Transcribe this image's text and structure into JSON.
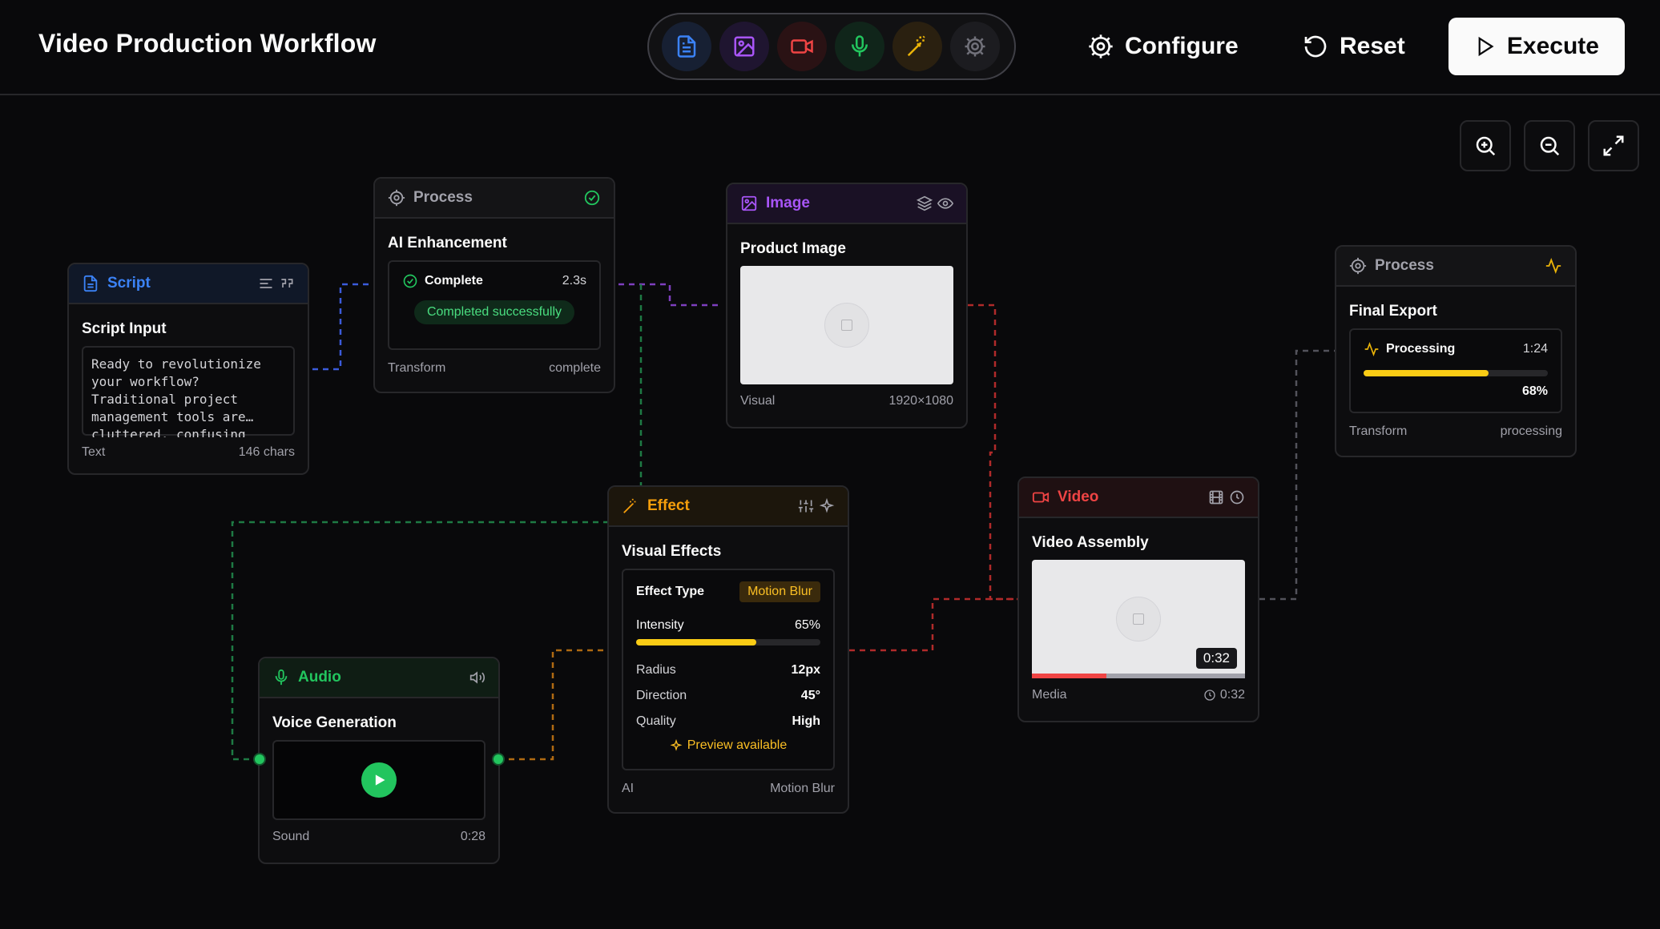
{
  "header": {
    "title": "Video Production Workflow",
    "configure_label": "Configure",
    "reset_label": "Reset",
    "execute_label": "Execute",
    "palette": [
      {
        "icon": "document-icon",
        "color": "#3b82f6"
      },
      {
        "icon": "image-icon",
        "color": "#a855f7"
      },
      {
        "icon": "video-icon",
        "color": "#ef4444"
      },
      {
        "icon": "microphone-icon",
        "color": "#22c55e"
      },
      {
        "icon": "magic-wand-icon",
        "color": "#eab308"
      },
      {
        "icon": "gear-icon",
        "color": "#71717a"
      }
    ]
  },
  "zoom_controls": [
    "zoom-in-icon",
    "zoom-out-icon",
    "fullscreen-icon"
  ],
  "nodes": {
    "script": {
      "category": "Script",
      "title": "Script Input",
      "text": "Ready to revolutionize\nyour workflow?\nTraditional project\nmanagement tools are…\ncluttered, confusing",
      "footer_left": "Text",
      "footer_right": "146 chars",
      "color": "#3b82f6"
    },
    "process_ai": {
      "category": "Process",
      "title": "AI Enhancement",
      "status": "Complete",
      "time": "2.3s",
      "badge": "Completed successfully",
      "footer_left": "Transform",
      "footer_right": "complete",
      "color": "#22c55e"
    },
    "image": {
      "category": "Image",
      "title": "Product Image",
      "footer_left": "Visual",
      "footer_right": "1920×1080",
      "color": "#a855f7"
    },
    "process_export": {
      "category": "Process",
      "title": "Final Export",
      "status": "Processing",
      "time": "1:24",
      "progress": 68,
      "progress_label": "68%",
      "footer_left": "Transform",
      "footer_right": "processing",
      "color": "#eab308"
    },
    "effect": {
      "category": "Effect",
      "title": "Visual Effects",
      "effect_type_label": "Effect Type",
      "effect_type_value": "Motion Blur",
      "intensity_label": "Intensity",
      "intensity_value": "65%",
      "intensity": 65,
      "params": [
        {
          "label": "Radius",
          "value": "12px"
        },
        {
          "label": "Direction",
          "value": "45°"
        },
        {
          "label": "Quality",
          "value": "High"
        }
      ],
      "preview_label": "Preview available",
      "footer_left": "AI",
      "footer_right": "Motion Blur",
      "color": "#f59e0b"
    },
    "video": {
      "category": "Video",
      "title": "Video Assembly",
      "duration_badge": "0:32",
      "playback_progress": 35,
      "footer_left": "Media",
      "footer_right": "0:32",
      "color": "#ef4444"
    },
    "audio": {
      "category": "Audio",
      "title": "Voice Generation",
      "footer_left": "Sound",
      "footer_right": "0:28",
      "color": "#22c55e"
    }
  }
}
